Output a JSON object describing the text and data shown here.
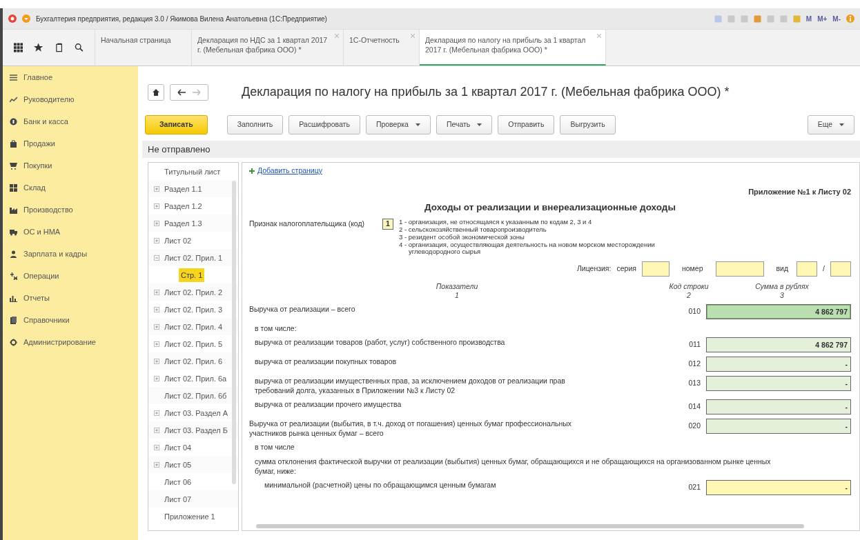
{
  "window": {
    "title": "Бухгалтерия предприятия, редакция 3.0 / Якимова Вилена Анатольевна (1С:Предприятие)",
    "calc_buttons": [
      "M",
      "M+",
      "M-"
    ]
  },
  "tabs": [
    {
      "label": "Начальная страница",
      "selected": false,
      "closable": false
    },
    {
      "label": "Декларация по НДС за 1 квартал 2017 г. (Мебельная фабрика ООО) *",
      "selected": false,
      "closable": true
    },
    {
      "label": "1С-Отчетность",
      "selected": false,
      "closable": true
    },
    {
      "label": "Декларация по налогу на прибыль за 1 квартал 2017 г. (Мебельная фабрика ООО) *",
      "selected": true,
      "closable": true
    }
  ],
  "sidebar": {
    "items": [
      {
        "label": "Главное"
      },
      {
        "label": "Руководителю"
      },
      {
        "label": "Банк и касса"
      },
      {
        "label": "Продажи"
      },
      {
        "label": "Покупки"
      },
      {
        "label": "Склад"
      },
      {
        "label": "Производство"
      },
      {
        "label": "ОС и НМА"
      },
      {
        "label": "Зарплата и кадры"
      },
      {
        "label": "Операции"
      },
      {
        "label": "Отчеты"
      },
      {
        "label": "Справочники"
      },
      {
        "label": "Администрирование"
      }
    ]
  },
  "document": {
    "title": "Декларация по налогу на прибыль за 1 квартал 2017 г. (Мебельная фабрика ООО) *",
    "toolbar": [
      {
        "label": "Записать",
        "kind": "primary"
      },
      {
        "label": "Заполнить",
        "kind": "plain"
      },
      {
        "label": "Расшифровать",
        "kind": "plain"
      },
      {
        "label": "Проверка",
        "kind": "dropdown"
      },
      {
        "label": "Печать",
        "kind": "dropdown"
      },
      {
        "label": "Отправить",
        "kind": "plain"
      },
      {
        "label": "Выгрузить",
        "kind": "plain"
      }
    ],
    "more_button": "Еще",
    "status": "Не отправлено"
  },
  "pages_tree": [
    {
      "label": "Титульный лист",
      "kind": "leaf",
      "selected": false
    },
    {
      "label": "Раздел 1.1",
      "kind": "expandable",
      "selected": false
    },
    {
      "label": "Раздел 1.2",
      "kind": "expandable",
      "selected": false
    },
    {
      "label": "Раздел 1.3",
      "kind": "expandable",
      "selected": false
    },
    {
      "label": "Лист 02",
      "kind": "expandable",
      "selected": false
    },
    {
      "label": "Лист 02. Прил. 1",
      "kind": "expanded",
      "selected": false,
      "children": [
        {
          "label": "Стр. 1",
          "kind": "leaf",
          "selected": true
        }
      ]
    },
    {
      "label": "Лист 02. Прил. 2",
      "kind": "expandable",
      "selected": false
    },
    {
      "label": "Лист 02. Прил. 3",
      "kind": "expandable",
      "selected": false
    },
    {
      "label": "Лист 02. Прил. 4",
      "kind": "expandable",
      "selected": false
    },
    {
      "label": "Лист 02. Прил. 5",
      "kind": "expandable",
      "selected": false
    },
    {
      "label": "Лист 02. Прил. 6",
      "kind": "expandable",
      "selected": false
    },
    {
      "label": "Лист 02. Прил. 6а",
      "kind": "expandable",
      "selected": false
    },
    {
      "label": "Лист 02. Прил. 6б",
      "kind": "leaf",
      "selected": false
    },
    {
      "label": "Лист 03. Раздел А",
      "kind": "expandable",
      "selected": false
    },
    {
      "label": "Лист 03. Раздел Б",
      "kind": "expandable",
      "selected": false
    },
    {
      "label": "Лист 04",
      "kind": "expandable",
      "selected": false
    },
    {
      "label": "Лист 05",
      "kind": "expandable",
      "selected": false
    },
    {
      "label": "Лист 06",
      "kind": "leaf",
      "selected": false
    },
    {
      "label": "Лист 07",
      "kind": "leaf",
      "selected": false
    },
    {
      "label": "Приложение 1",
      "kind": "leaf",
      "selected": false
    }
  ],
  "form": {
    "add_page_link": "Добавить страницу",
    "appendix": "Приложение №1 к Листу 02",
    "heading": "Доходы от реализации и внереализационные доходы",
    "taxpayer_label": "Признак налогоплательщика (код)",
    "taxpayer_code": "1",
    "taxpayer_options": [
      "1 - организация, не относящаяся к указанным по кодам 2, 3 и 4",
      "2 - сельскохозяйственный товаропроизводитель",
      "3 - резидент особой экономической зоны",
      "4 - организация, осуществляющая деятельность на новом морском месторождении",
      "углеводородного сырья"
    ],
    "license": {
      "label": "Лицензия:",
      "series_label": "серия",
      "number_label": "номер",
      "type_label": "вид",
      "separator": "/"
    },
    "columns": [
      {
        "title": "Показатели",
        "number": "1"
      },
      {
        "title": "Код строки",
        "number": "2"
      },
      {
        "title": "Сумма в рублях",
        "number": "3"
      }
    ],
    "rows": [
      {
        "kind": "total",
        "label": "Выручка от реализации – всего",
        "code": "010",
        "value": "4 862 797"
      },
      {
        "kind": "caption",
        "label": "в том числе:"
      },
      {
        "kind": "item",
        "label": "выручка от реализации товаров (работ, услуг) собственного производства",
        "code": "011",
        "value": "4 862 797"
      },
      {
        "kind": "item",
        "label": "выручка от реализации покупных товаров",
        "code": "012",
        "value": "-"
      },
      {
        "kind": "item",
        "label": "выручка от реализации имущественных прав, за исключением доходов от реализации прав требований долга, указанных в Приложении №3 к Листу 02",
        "code": "013",
        "value": "-"
      },
      {
        "kind": "item",
        "label": "выручка от реализации прочего имущества",
        "code": "014",
        "value": "-"
      },
      {
        "kind": "subtotal",
        "label": "Выручка от реализации (выбытия, в т.ч. доход от погашения) ценных бумаг профессиональных участников рынка ценных бумаг – всего",
        "code": "020",
        "value": "-"
      },
      {
        "kind": "caption",
        "label": "в том числе"
      },
      {
        "kind": "caption",
        "label": "сумма отклонения фактической выручки от реализации (выбытия) ценных бумаг, обращающихся и не обращающихся на организованном рынке ценных бумаг, ниже:"
      },
      {
        "kind": "input",
        "label": "минимальной (расчетной) цены по обращающимся ценным бумагам",
        "code": "021",
        "value": "-"
      }
    ]
  }
}
